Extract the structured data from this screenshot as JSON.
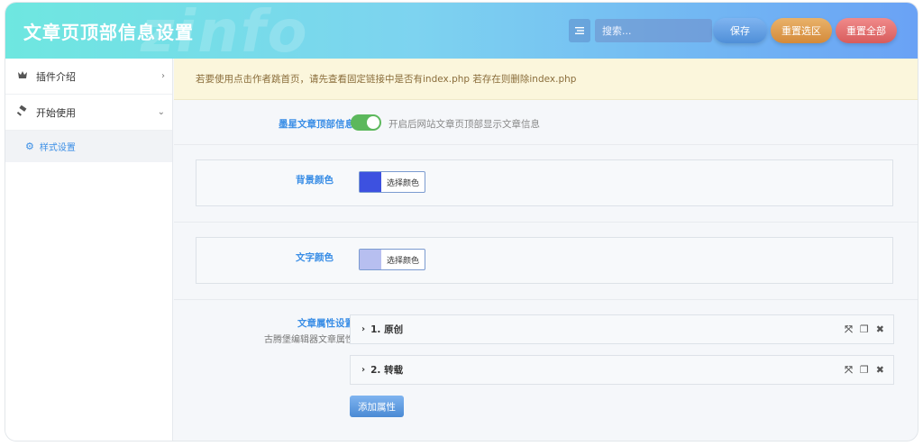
{
  "header": {
    "title": "文章页顶部信息设置",
    "watermark": "zinfo",
    "search_placeholder": "搜索...",
    "save_label": "保存",
    "reset_section_label": "重置选区",
    "reset_all_label": "重置全部"
  },
  "sidebar": {
    "items": [
      {
        "label": "插件介绍",
        "icon": "gift-icon",
        "chevron": "›"
      },
      {
        "label": "开始使用",
        "icon": "gavel-icon",
        "chevron": "⌄"
      }
    ],
    "sub_items": [
      {
        "label": "样式设置",
        "icon": "gears-icon"
      }
    ]
  },
  "notice": "若要使用点击作者跳首页，请先查看固定链接中是否有index.php 若存在则删除index.php",
  "fields": {
    "top_info": {
      "label": "墨星文章顶部信息",
      "toggle_on": true,
      "description": "开启后网站文章页顶部显示文章信息"
    },
    "bg_color": {
      "label": "背景颜色",
      "button_label": "选择颜色",
      "color": "#3d51e0"
    },
    "text_color": {
      "label": "文字颜色",
      "button_label": "选择颜色",
      "color": "#b7bff0"
    },
    "attributes": {
      "label": "文章属性设置",
      "sublabel": "古腾堡编辑器文章属性",
      "items": [
        {
          "label": "1. 原创"
        },
        {
          "label": "2. 转载"
        }
      ],
      "add_label": "添加属性"
    }
  },
  "colors": {
    "accent": "#3a8ee6",
    "toggle": "#5cb85c",
    "notice_bg": "#fbf6dc",
    "notice_text": "#8a6d3b"
  }
}
